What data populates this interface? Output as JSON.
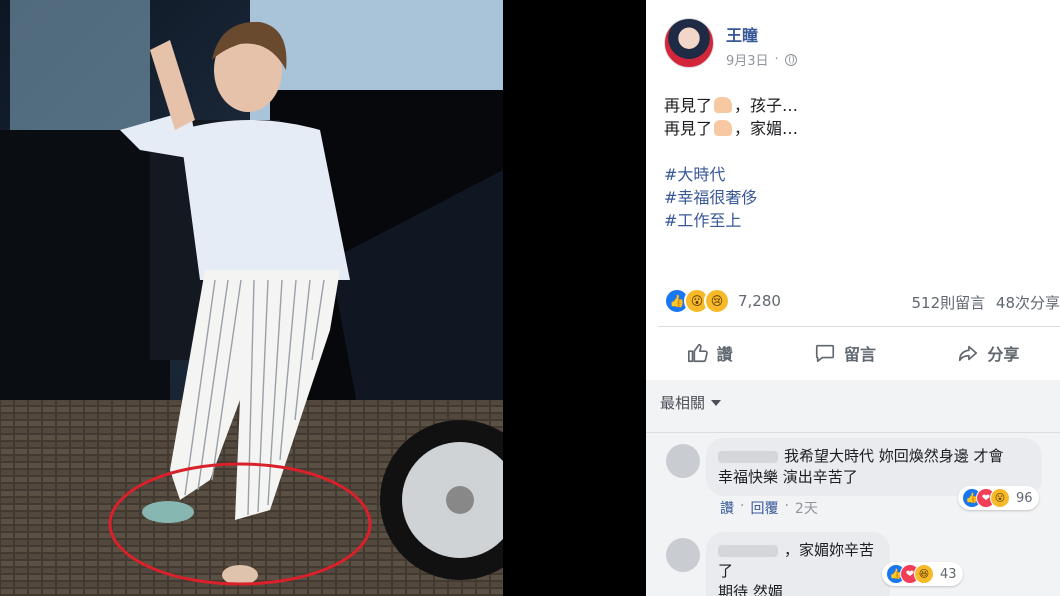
{
  "post": {
    "author": "王瞳",
    "date": "9月3日",
    "lines": [
      "再見了",
      "，孩子…",
      "再見了",
      "，家媚…"
    ],
    "hashtags": [
      "#大時代",
      "#幸福很奢侈",
      "#工作至上"
    ],
    "reaction_count": "7,280",
    "comments_count": "512則留言",
    "shares_count": "48次分享"
  },
  "actions": {
    "like": "讚",
    "comment": "留言",
    "share": "分享"
  },
  "comments_section": {
    "sort_label": "最相關",
    "comments": [
      {
        "text_line1": "我希望大時代 妳回煥然身邊 才會",
        "text_line2": "幸福快樂 演出辛苦了",
        "reactions": "96",
        "like_label": "讚",
        "reply_label": "回覆",
        "time": "2天"
      },
      {
        "text_line1": "，家媚妳辛苦了",
        "text_line2": "期待 然媚",
        "reactions": "43"
      }
    ]
  },
  "icons": {
    "globe": "globe-icon",
    "like": "thumbs-up-icon",
    "comment": "speech-bubble-icon",
    "share": "share-arrow-icon"
  },
  "colors": {
    "link": "#385898",
    "muted": "#90949c",
    "like_blue": "#1877f2",
    "circle_red": "#d9202b"
  }
}
